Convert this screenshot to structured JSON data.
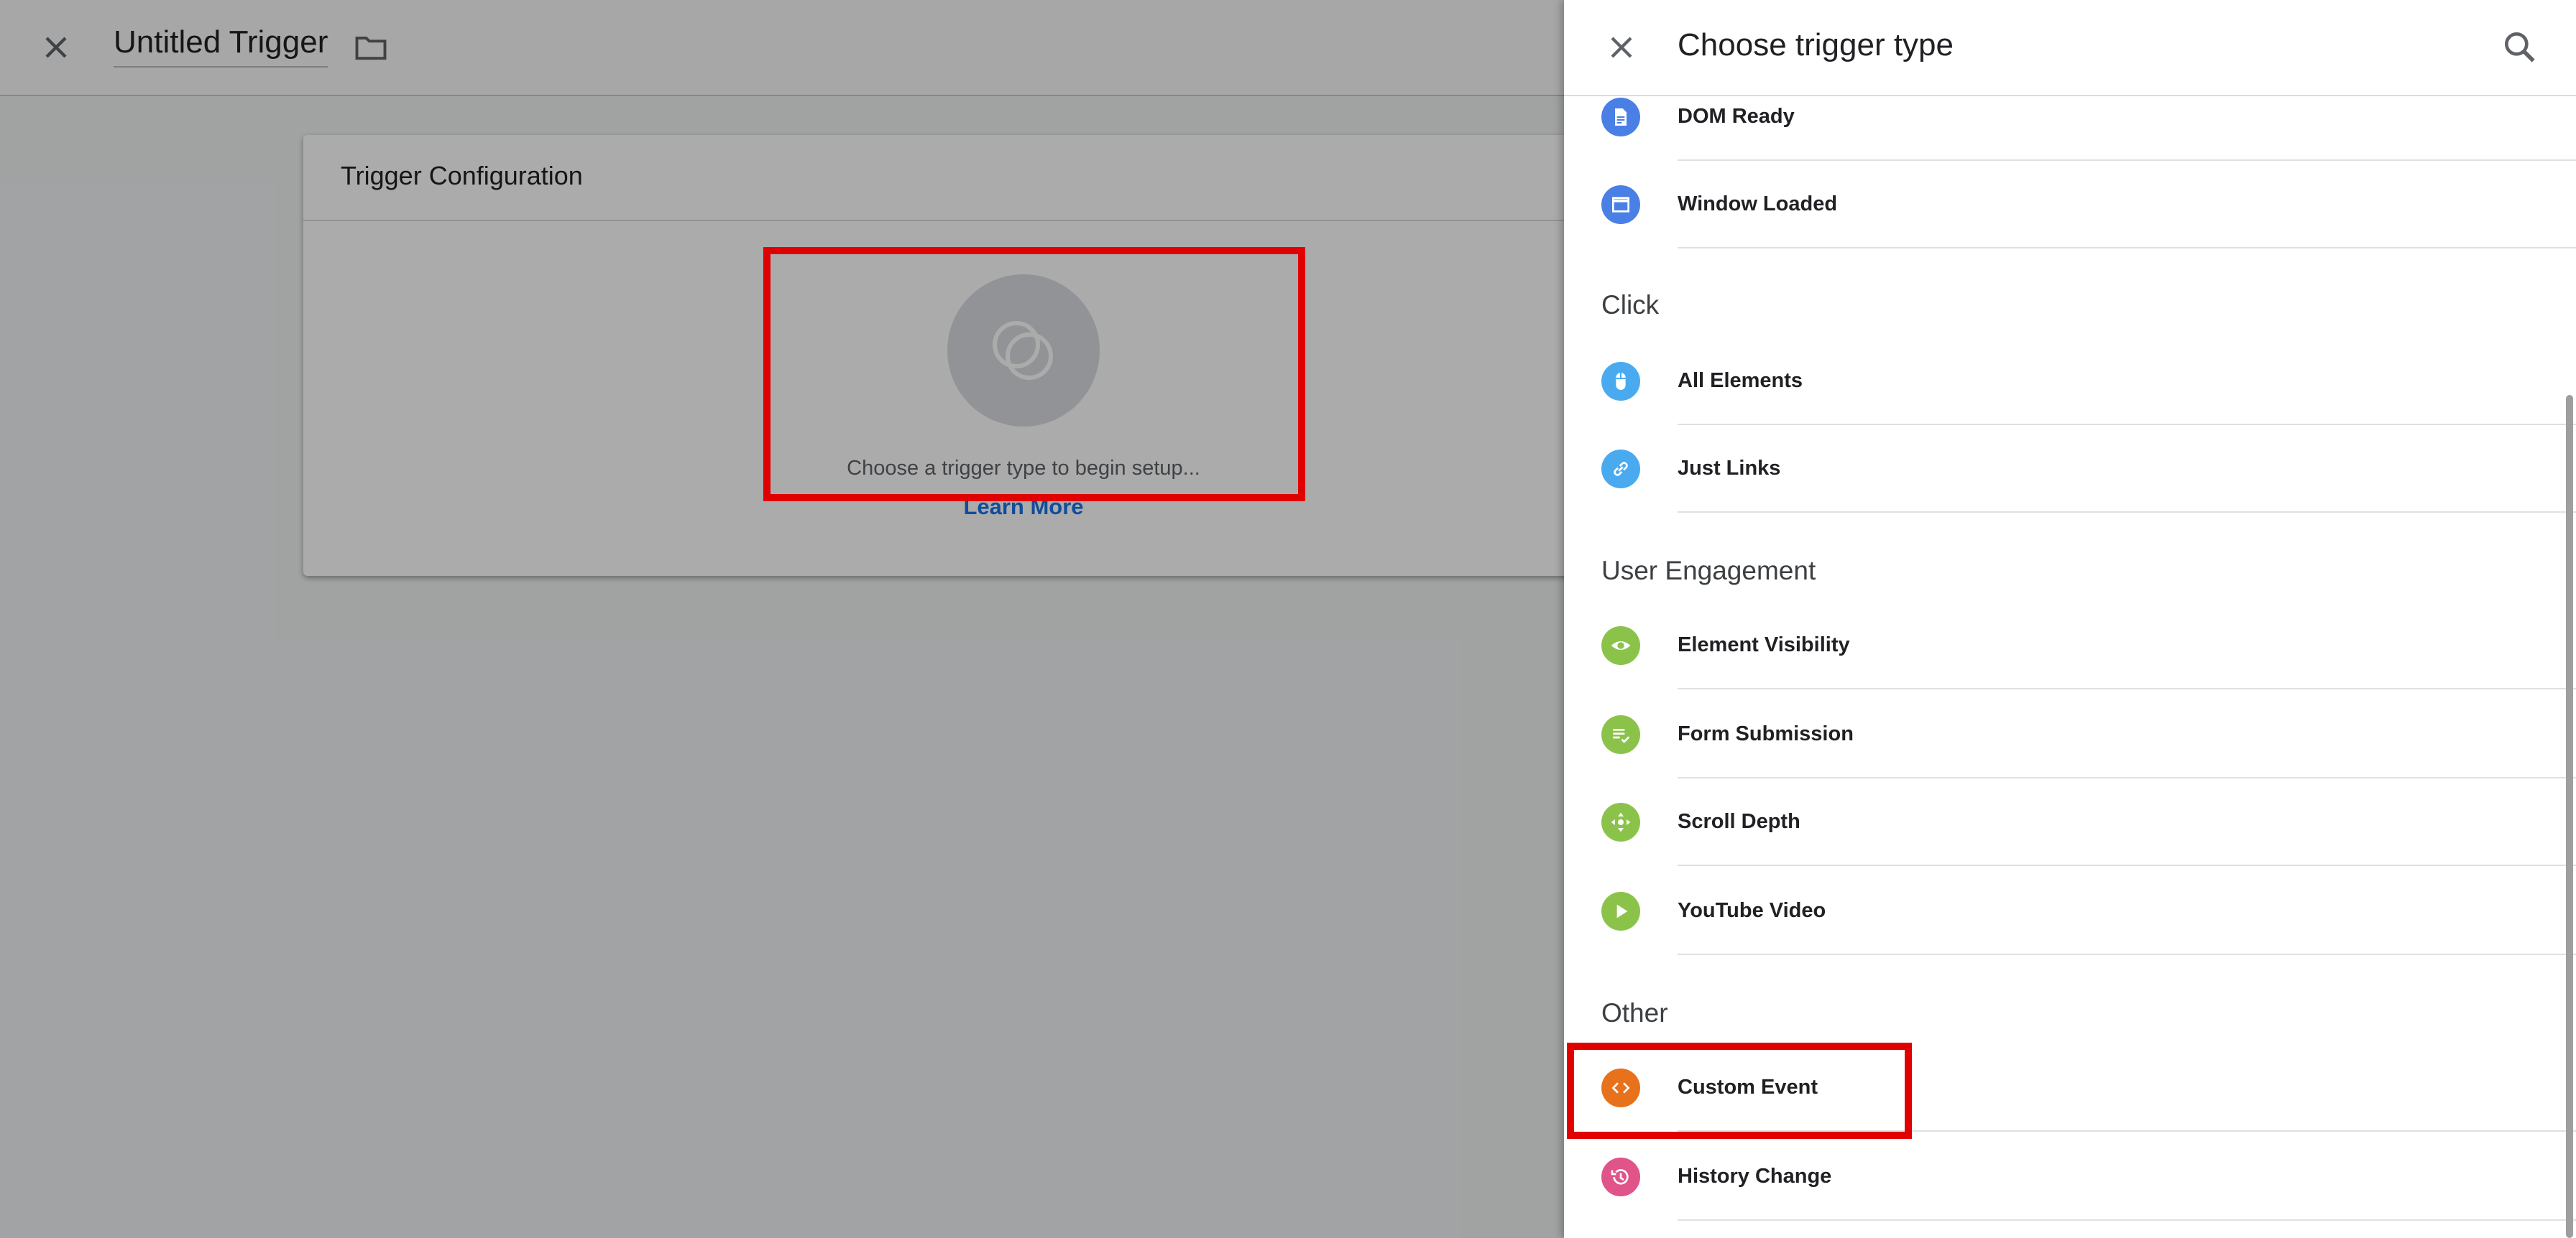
{
  "header": {
    "trigger_name": "Untitled Trigger"
  },
  "card": {
    "title": "Trigger Configuration",
    "placeholder_text": "Choose a trigger type to begin setup...",
    "learn_more": "Learn More"
  },
  "panel": {
    "title": "Choose trigger type",
    "sections": {
      "page_items": [
        {
          "label": "DOM Ready",
          "icon": "document-icon",
          "color": "#4a7fe6"
        },
        {
          "label": "Window Loaded",
          "icon": "window-icon",
          "color": "#4a7fe6"
        }
      ],
      "click_title": "Click",
      "click_items": [
        {
          "label": "All Elements",
          "icon": "mouse-icon",
          "color": "#4aaaf0"
        },
        {
          "label": "Just Links",
          "icon": "link-icon",
          "color": "#4aaaf0"
        }
      ],
      "engagement_title": "User Engagement",
      "engagement_items": [
        {
          "label": "Element Visibility",
          "icon": "eye-icon",
          "color": "#8bc34a"
        },
        {
          "label": "Form Submission",
          "icon": "form-check-icon",
          "color": "#8bc34a"
        },
        {
          "label": "Scroll Depth",
          "icon": "move-arrows-icon",
          "color": "#8bc34a"
        },
        {
          "label": "YouTube Video",
          "icon": "play-icon",
          "color": "#8bc34a"
        }
      ],
      "other_title": "Other",
      "other_items": [
        {
          "label": "Custom Event",
          "icon": "code-icon",
          "color": "#e8711c"
        },
        {
          "label": "History Change",
          "icon": "history-icon",
          "color": "#e0548a"
        }
      ]
    }
  },
  "colors": {
    "highlight": "#e00000",
    "link": "#1a73e8"
  }
}
